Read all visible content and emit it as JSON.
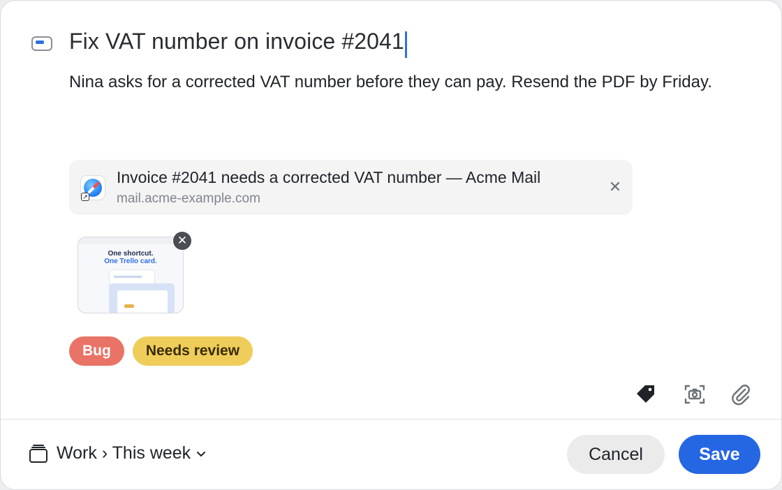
{
  "card": {
    "title": "Fix VAT number on invoice #2041",
    "description": "Nina asks for a corrected VAT number before they can pay. Resend the PDF by Friday."
  },
  "attachment_link": {
    "title": "Invoice #2041 needs a corrected VAT number — Acme Mail",
    "url": "mail.acme-example.com",
    "icon": "safari-icon"
  },
  "screenshot_thumb": {
    "heading1": "One shortcut.",
    "heading2": "One Trello card."
  },
  "labels": [
    {
      "text": "Bug",
      "color": "#e97366"
    },
    {
      "text": "Needs review",
      "color": "#eecd5b"
    }
  ],
  "toolbar": {
    "icons": [
      "tag-icon",
      "screenshot-icon",
      "paperclip-icon"
    ]
  },
  "footer": {
    "list_path": "Work › This week",
    "cancel_label": "Cancel",
    "save_label": "Save"
  },
  "colors": {
    "accent": "#2566e3",
    "caret": "#2f6fe0"
  }
}
